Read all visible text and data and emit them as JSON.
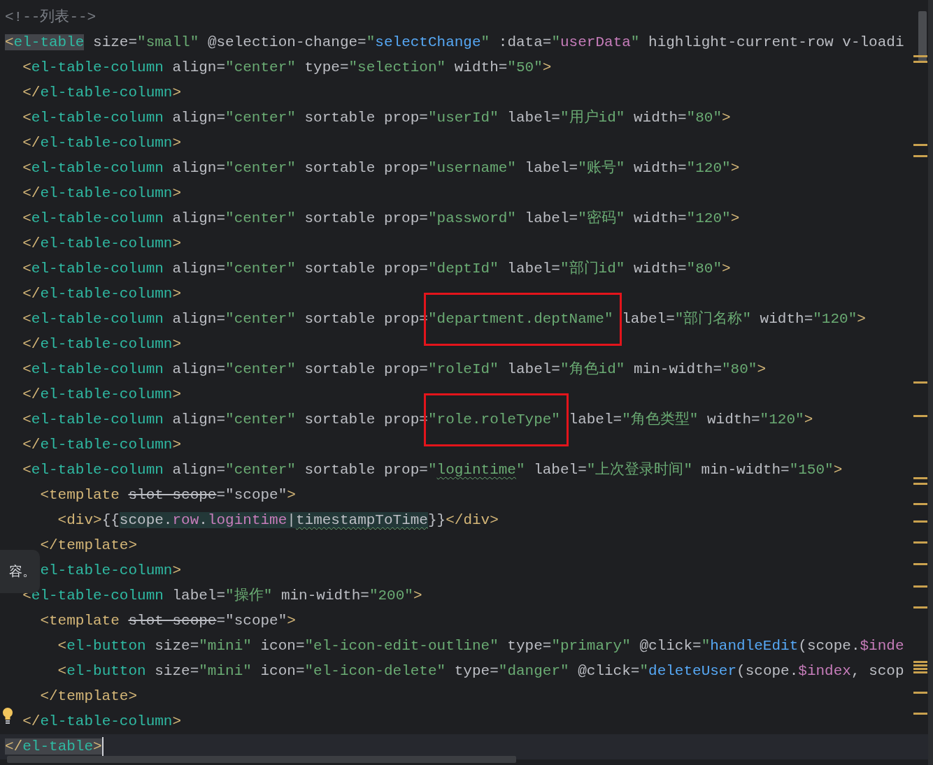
{
  "editor": {
    "lines": [
      {
        "tokens": [
          {
            "text": "<!--列表-->",
            "kind": "comment"
          }
        ]
      },
      {
        "tokens": [
          {
            "text": "<",
            "kind": "punct",
            "match": true
          },
          {
            "text": "el-table",
            "kind": "tag",
            "match": true
          },
          {
            "text": " size=",
            "kind": "attr"
          },
          {
            "text": "\"small\"",
            "kind": "string"
          },
          {
            "text": " @selection-change=",
            "kind": "attr"
          },
          {
            "text": "\"",
            "kind": "string"
          },
          {
            "text": "selectChange",
            "kind": "func"
          },
          {
            "text": "\"",
            "kind": "string"
          },
          {
            "text": " :data=",
            "kind": "attr"
          },
          {
            "text": "\"",
            "kind": "string"
          },
          {
            "text": "userData",
            "kind": "var"
          },
          {
            "text": "\"",
            "kind": "string"
          },
          {
            "text": " highlight-current-row v-loadi",
            "kind": "attr"
          }
        ]
      },
      {
        "tokens": [
          {
            "text": "  <",
            "kind": "punct"
          },
          {
            "text": "el-table-column",
            "kind": "tag"
          },
          {
            "text": " align=",
            "kind": "attr"
          },
          {
            "text": "\"center\"",
            "kind": "string"
          },
          {
            "text": " type=",
            "kind": "attr"
          },
          {
            "text": "\"selection\"",
            "kind": "string"
          },
          {
            "text": " width=",
            "kind": "attr"
          },
          {
            "text": "\"50\"",
            "kind": "string"
          },
          {
            "text": ">",
            "kind": "punct"
          }
        ]
      },
      {
        "tokens": [
          {
            "text": "  </",
            "kind": "punct"
          },
          {
            "text": "el-table-column",
            "kind": "tag"
          },
          {
            "text": ">",
            "kind": "punct"
          }
        ]
      },
      {
        "tokens": [
          {
            "text": "  <",
            "kind": "punct"
          },
          {
            "text": "el-table-column",
            "kind": "tag"
          },
          {
            "text": " align=",
            "kind": "attr"
          },
          {
            "text": "\"center\"",
            "kind": "string"
          },
          {
            "text": " sortable prop=",
            "kind": "attr"
          },
          {
            "text": "\"userId\"",
            "kind": "string"
          },
          {
            "text": " label=",
            "kind": "attr"
          },
          {
            "text": "\"用户id\"",
            "kind": "string"
          },
          {
            "text": " width=",
            "kind": "attr"
          },
          {
            "text": "\"80\"",
            "kind": "string"
          },
          {
            "text": ">",
            "kind": "punct"
          }
        ]
      },
      {
        "tokens": [
          {
            "text": "  </",
            "kind": "punct"
          },
          {
            "text": "el-table-column",
            "kind": "tag"
          },
          {
            "text": ">",
            "kind": "punct"
          }
        ]
      },
      {
        "tokens": [
          {
            "text": "  <",
            "kind": "punct"
          },
          {
            "text": "el-table-column",
            "kind": "tag"
          },
          {
            "text": " align=",
            "kind": "attr"
          },
          {
            "text": "\"center\"",
            "kind": "string"
          },
          {
            "text": " sortable prop=",
            "kind": "attr"
          },
          {
            "text": "\"username\"",
            "kind": "string"
          },
          {
            "text": " label=",
            "kind": "attr"
          },
          {
            "text": "\"账号\"",
            "kind": "string"
          },
          {
            "text": " width=",
            "kind": "attr"
          },
          {
            "text": "\"120\"",
            "kind": "string"
          },
          {
            "text": ">",
            "kind": "punct"
          }
        ]
      },
      {
        "tokens": [
          {
            "text": "  </",
            "kind": "punct"
          },
          {
            "text": "el-table-column",
            "kind": "tag"
          },
          {
            "text": ">",
            "kind": "punct"
          }
        ]
      },
      {
        "tokens": [
          {
            "text": "  <",
            "kind": "punct"
          },
          {
            "text": "el-table-column",
            "kind": "tag"
          },
          {
            "text": " align=",
            "kind": "attr"
          },
          {
            "text": "\"center\"",
            "kind": "string"
          },
          {
            "text": " sortable prop=",
            "kind": "attr"
          },
          {
            "text": "\"password\"",
            "kind": "string"
          },
          {
            "text": " label=",
            "kind": "attr"
          },
          {
            "text": "\"密码\"",
            "kind": "string"
          },
          {
            "text": " width=",
            "kind": "attr"
          },
          {
            "text": "\"120\"",
            "kind": "string"
          },
          {
            "text": ">",
            "kind": "punct"
          }
        ]
      },
      {
        "tokens": [
          {
            "text": "  </",
            "kind": "punct"
          },
          {
            "text": "el-table-column",
            "kind": "tag"
          },
          {
            "text": ">",
            "kind": "punct"
          }
        ]
      },
      {
        "tokens": [
          {
            "text": "  <",
            "kind": "punct"
          },
          {
            "text": "el-table-column",
            "kind": "tag"
          },
          {
            "text": " align=",
            "kind": "attr"
          },
          {
            "text": "\"center\"",
            "kind": "string"
          },
          {
            "text": " sortable prop=",
            "kind": "attr"
          },
          {
            "text": "\"deptId\"",
            "kind": "string"
          },
          {
            "text": " label=",
            "kind": "attr"
          },
          {
            "text": "\"部门id\"",
            "kind": "string"
          },
          {
            "text": " width=",
            "kind": "attr"
          },
          {
            "text": "\"80\"",
            "kind": "string"
          },
          {
            "text": ">",
            "kind": "punct"
          }
        ]
      },
      {
        "tokens": [
          {
            "text": "  </",
            "kind": "punct"
          },
          {
            "text": "el-table-column",
            "kind": "tag"
          },
          {
            "text": ">",
            "kind": "punct"
          }
        ]
      },
      {
        "tokens": [
          {
            "text": "  <",
            "kind": "punct"
          },
          {
            "text": "el-table-column",
            "kind": "tag"
          },
          {
            "text": " align=",
            "kind": "attr"
          },
          {
            "text": "\"center\"",
            "kind": "string"
          },
          {
            "text": " sortable prop=",
            "kind": "attr"
          },
          {
            "text": "\"department.deptName\"",
            "kind": "string",
            "boxed": true
          },
          {
            "text": " label=",
            "kind": "attr"
          },
          {
            "text": "\"部门名称\"",
            "kind": "string"
          },
          {
            "text": " width=",
            "kind": "attr"
          },
          {
            "text": "\"120\"",
            "kind": "string"
          },
          {
            "text": ">",
            "kind": "punct"
          }
        ]
      },
      {
        "tokens": [
          {
            "text": "  </",
            "kind": "punct"
          },
          {
            "text": "el-table-column",
            "kind": "tag"
          },
          {
            "text": ">",
            "kind": "punct"
          }
        ]
      },
      {
        "tokens": [
          {
            "text": "  <",
            "kind": "punct"
          },
          {
            "text": "el-table-column",
            "kind": "tag"
          },
          {
            "text": " align=",
            "kind": "attr"
          },
          {
            "text": "\"center\"",
            "kind": "string"
          },
          {
            "text": " sortable prop=",
            "kind": "attr"
          },
          {
            "text": "\"roleId\"",
            "kind": "string"
          },
          {
            "text": " label=",
            "kind": "attr"
          },
          {
            "text": "\"角色id\"",
            "kind": "string"
          },
          {
            "text": " min-width=",
            "kind": "attr"
          },
          {
            "text": "\"80\"",
            "kind": "string"
          },
          {
            "text": ">",
            "kind": "punct"
          }
        ]
      },
      {
        "tokens": [
          {
            "text": "  </",
            "kind": "punct"
          },
          {
            "text": "el-table-column",
            "kind": "tag"
          },
          {
            "text": ">",
            "kind": "punct"
          }
        ]
      },
      {
        "tokens": [
          {
            "text": "  <",
            "kind": "punct"
          },
          {
            "text": "el-table-column",
            "kind": "tag"
          },
          {
            "text": " align=",
            "kind": "attr"
          },
          {
            "text": "\"center\"",
            "kind": "string"
          },
          {
            "text": " sortable prop=",
            "kind": "attr"
          },
          {
            "text": "\"role.roleType\"",
            "kind": "string",
            "boxed": true
          },
          {
            "text": " label=",
            "kind": "attr"
          },
          {
            "text": "\"角色类型\"",
            "kind": "string"
          },
          {
            "text": " width=",
            "kind": "attr"
          },
          {
            "text": "\"120\"",
            "kind": "string"
          },
          {
            "text": ">",
            "kind": "punct"
          }
        ]
      },
      {
        "tokens": [
          {
            "text": "  </",
            "kind": "punct"
          },
          {
            "text": "el-table-column",
            "kind": "tag"
          },
          {
            "text": ">",
            "kind": "punct"
          }
        ]
      },
      {
        "tokens": [
          {
            "text": "  <",
            "kind": "punct"
          },
          {
            "text": "el-table-column",
            "kind": "tag"
          },
          {
            "text": " align=",
            "kind": "attr"
          },
          {
            "text": "\"center\"",
            "kind": "string"
          },
          {
            "text": " sortable prop=",
            "kind": "attr"
          },
          {
            "text": "\"",
            "kind": "string"
          },
          {
            "text": "logintime",
            "kind": "string",
            "warning": true
          },
          {
            "text": "\"",
            "kind": "string"
          },
          {
            "text": " label=",
            "kind": "attr"
          },
          {
            "text": "\"上次登录时间\"",
            "kind": "string"
          },
          {
            "text": " min-width=",
            "kind": "attr"
          },
          {
            "text": "\"150\"",
            "kind": "string"
          },
          {
            "text": ">",
            "kind": "punct"
          }
        ]
      },
      {
        "tokens": [
          {
            "text": "    <template ",
            "kind": "punct"
          },
          {
            "text": "slot-scope",
            "kind": "attr",
            "deprecated": true
          },
          {
            "text": "=",
            "kind": "attr"
          },
          {
            "text": "\"scope\"",
            "kind": "attr"
          },
          {
            "text": ">",
            "kind": "punct"
          }
        ]
      },
      {
        "tokens": [
          {
            "text": "      <div>",
            "kind": "punct"
          },
          {
            "text": "{{",
            "kind": "attr"
          },
          {
            "text": "scope.",
            "kind": "attr",
            "injected": true
          },
          {
            "text": "row",
            "kind": "var",
            "injected": true
          },
          {
            "text": ".",
            "kind": "attr",
            "injected": true
          },
          {
            "text": "logintime",
            "kind": "var",
            "injected": true
          },
          {
            "text": "|",
            "kind": "attr",
            "injected": true
          },
          {
            "text": "timestampToTime",
            "kind": "attr",
            "injected": true,
            "warning": true
          },
          {
            "text": "}}",
            "kind": "attr"
          },
          {
            "text": "</div>",
            "kind": "punct"
          }
        ]
      },
      {
        "tokens": [
          {
            "text": "    </template>",
            "kind": "punct"
          }
        ]
      },
      {
        "tokens": [
          {
            "text": "    el-table-column",
            "kind": "tag"
          },
          {
            "text": ">",
            "kind": "punct"
          }
        ]
      },
      {
        "tokens": [
          {
            "text": "  <",
            "kind": "punct"
          },
          {
            "text": "el-table-column",
            "kind": "tag"
          },
          {
            "text": " label=",
            "kind": "attr"
          },
          {
            "text": "\"操作\"",
            "kind": "string"
          },
          {
            "text": " min-width=",
            "kind": "attr"
          },
          {
            "text": "\"200\"",
            "kind": "string"
          },
          {
            "text": ">",
            "kind": "punct"
          }
        ]
      },
      {
        "tokens": [
          {
            "text": "    <template ",
            "kind": "punct"
          },
          {
            "text": "slot-scope",
            "kind": "attr",
            "deprecated": true
          },
          {
            "text": "=",
            "kind": "attr"
          },
          {
            "text": "\"scope\"",
            "kind": "attr"
          },
          {
            "text": ">",
            "kind": "punct"
          }
        ]
      },
      {
        "tokens": [
          {
            "text": "      <",
            "kind": "punct"
          },
          {
            "text": "el-button",
            "kind": "tag"
          },
          {
            "text": " size=",
            "kind": "attr"
          },
          {
            "text": "\"mini\"",
            "kind": "string"
          },
          {
            "text": " icon=",
            "kind": "attr"
          },
          {
            "text": "\"el-icon-edit-outline\"",
            "kind": "string"
          },
          {
            "text": " type=",
            "kind": "attr"
          },
          {
            "text": "\"primary\"",
            "kind": "string"
          },
          {
            "text": " @click=",
            "kind": "attr"
          },
          {
            "text": "\"",
            "kind": "string"
          },
          {
            "text": "handleEdit",
            "kind": "func"
          },
          {
            "text": "(scope.",
            "kind": "attr"
          },
          {
            "text": "$inde",
            "kind": "var"
          }
        ]
      },
      {
        "tokens": [
          {
            "text": "      <",
            "kind": "punct"
          },
          {
            "text": "el-button",
            "kind": "tag"
          },
          {
            "text": " size=",
            "kind": "attr"
          },
          {
            "text": "\"mini\"",
            "kind": "string"
          },
          {
            "text": " icon=",
            "kind": "attr"
          },
          {
            "text": "\"el-icon-delete\"",
            "kind": "string"
          },
          {
            "text": " type=",
            "kind": "attr"
          },
          {
            "text": "\"danger\"",
            "kind": "string"
          },
          {
            "text": " @click=",
            "kind": "attr"
          },
          {
            "text": "\"",
            "kind": "string"
          },
          {
            "text": "deleteUser",
            "kind": "func"
          },
          {
            "text": "(scope.",
            "kind": "attr"
          },
          {
            "text": "$index",
            "kind": "var"
          },
          {
            "text": ", scop",
            "kind": "attr"
          }
        ]
      },
      {
        "tokens": [
          {
            "text": "    </template>",
            "kind": "punct"
          }
        ]
      },
      {
        "hint": true,
        "tokens": [
          {
            "text": "  </",
            "kind": "punct"
          },
          {
            "text": "el-table-column",
            "kind": "tag"
          },
          {
            "text": ">",
            "kind": "punct"
          }
        ]
      },
      {
        "current": true,
        "tokens": [
          {
            "text": "</",
            "kind": "punct",
            "match": true
          },
          {
            "text": "el-table",
            "kind": "tag",
            "match": true
          },
          {
            "text": ">",
            "kind": "punct",
            "match": true
          }
        ]
      }
    ]
  },
  "tooltip": {
    "text": "容。"
  }
}
